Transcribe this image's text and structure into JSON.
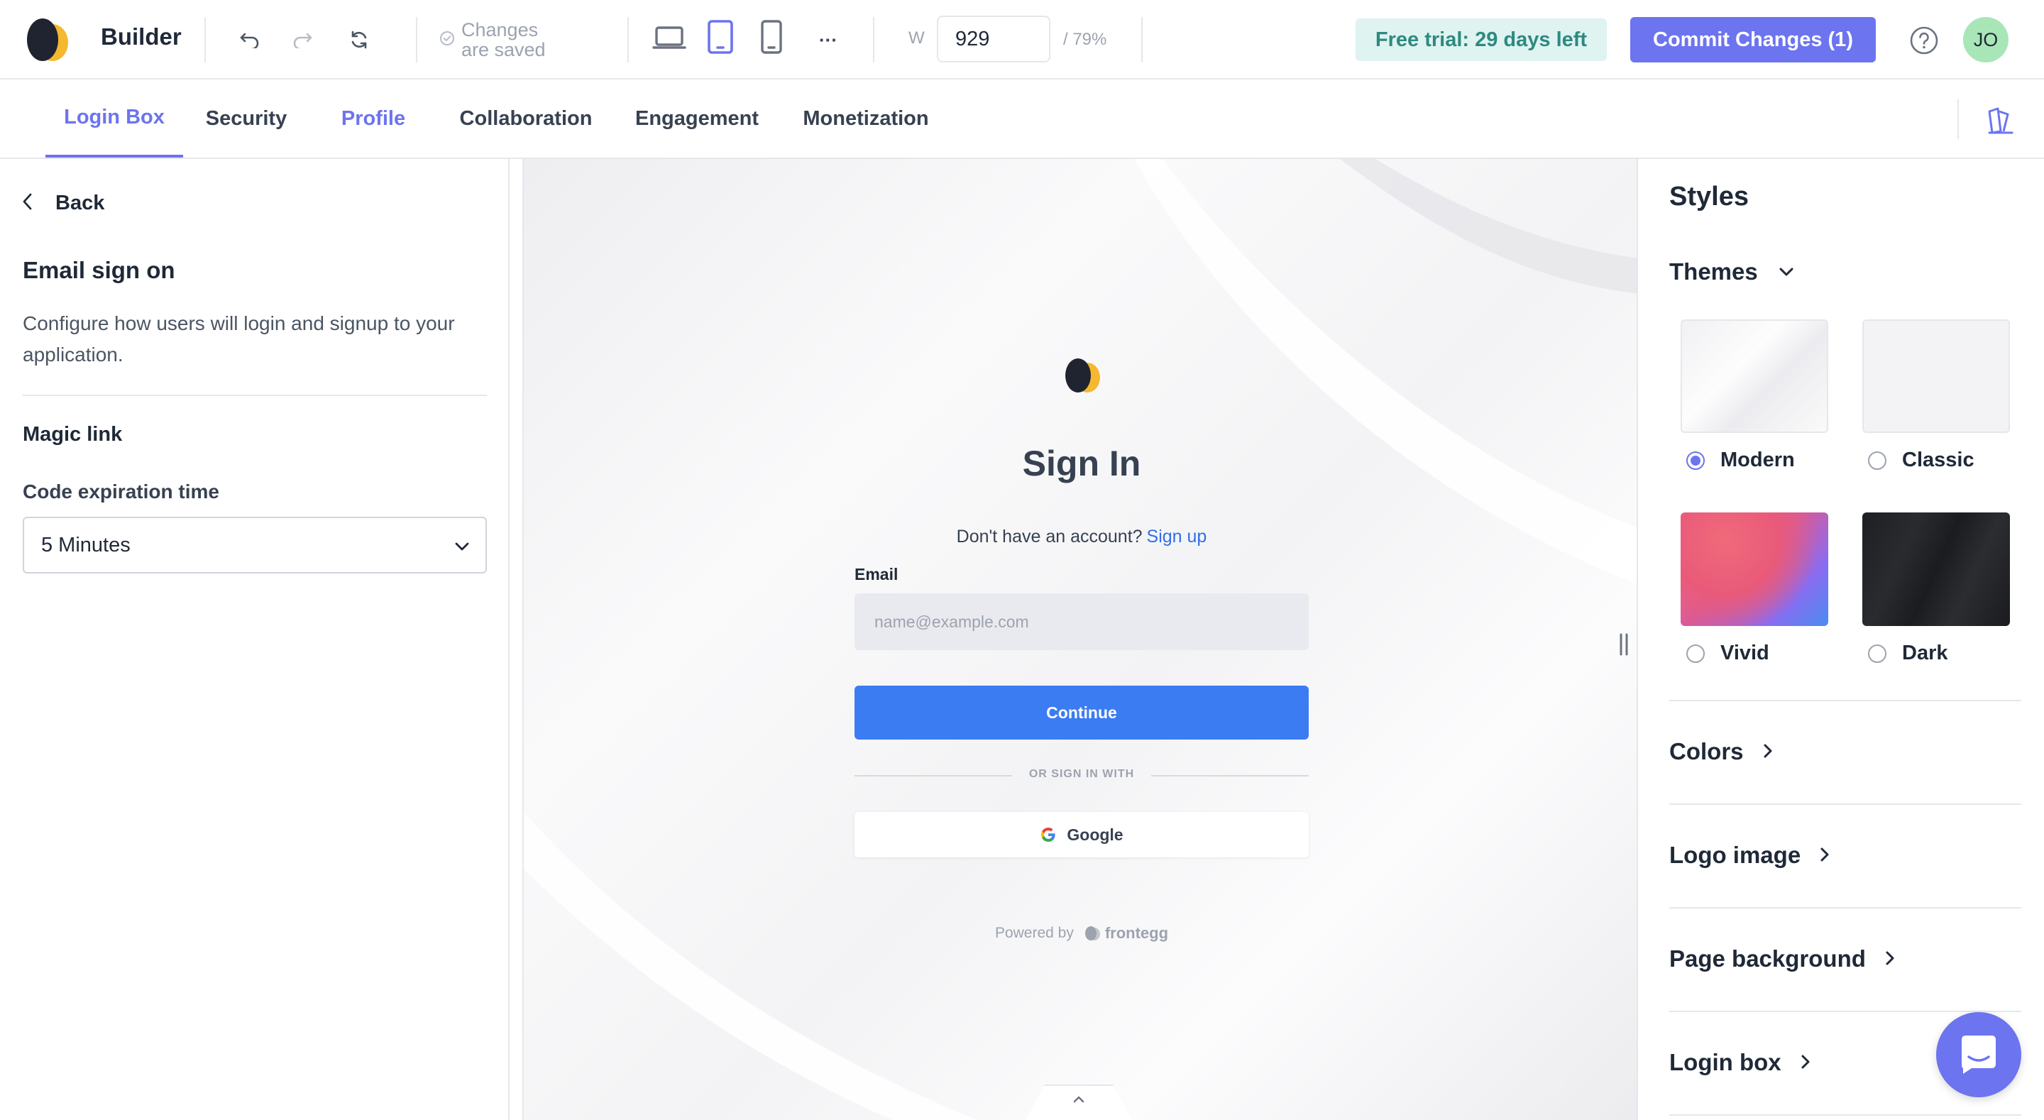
{
  "header": {
    "app_title": "Builder",
    "saved_status": "Changes are saved",
    "width_label": "W",
    "width_value": "929",
    "zoom": "/ 79%",
    "more_label": "···",
    "trial_badge": "Free trial: 29 days left",
    "commit_label": "Commit Changes (1)",
    "avatar_initials": "JO",
    "icons": [
      "undo-icon",
      "redo-icon",
      "refresh-icon",
      "check-circle-icon",
      "desktop-icon",
      "tablet-icon",
      "mobile-icon",
      "help-icon"
    ]
  },
  "tabs": [
    {
      "label": "Login Box",
      "state": "active"
    },
    {
      "label": "Security",
      "state": "default"
    },
    {
      "label": "Profile",
      "state": "highlight"
    },
    {
      "label": "Collaboration",
      "state": "default"
    },
    {
      "label": "Engagement",
      "state": "default"
    },
    {
      "label": "Monetization",
      "state": "default"
    }
  ],
  "left_panel": {
    "back_label": "Back",
    "section_title": "Email sign on",
    "description": "Configure how users will login and signup to your application.",
    "magic_link_label": "Magic link",
    "code_expiration_label": "Code expiration time",
    "code_expiration_value": "5 Minutes"
  },
  "preview": {
    "title": "Sign In",
    "no_account_text": "Don't have an account?",
    "sign_up_link": "Sign up",
    "email_label": "Email",
    "email_placeholder": "name@example.com",
    "continue_label": "Continue",
    "divider_text": "OR SIGN IN WITH",
    "google_label": "Google",
    "powered_by": "Powered by",
    "brand": "frontegg"
  },
  "right_panel": {
    "title": "Styles",
    "themes_label": "Themes",
    "themes": [
      {
        "name": "Modern",
        "selected": true
      },
      {
        "name": "Classic",
        "selected": false
      },
      {
        "name": "Vivid",
        "selected": false
      },
      {
        "name": "Dark",
        "selected": false
      }
    ],
    "sections": [
      "Colors",
      "Logo image",
      "Page background",
      "Login box"
    ]
  },
  "colors": {
    "accent": "#6c74f0",
    "primary_button": "#3b7cf3",
    "trial_bg": "#dff3f1",
    "trial_text": "#2d8a7f",
    "logo_dark": "#1f2430",
    "logo_yellow": "#f5b82e"
  }
}
